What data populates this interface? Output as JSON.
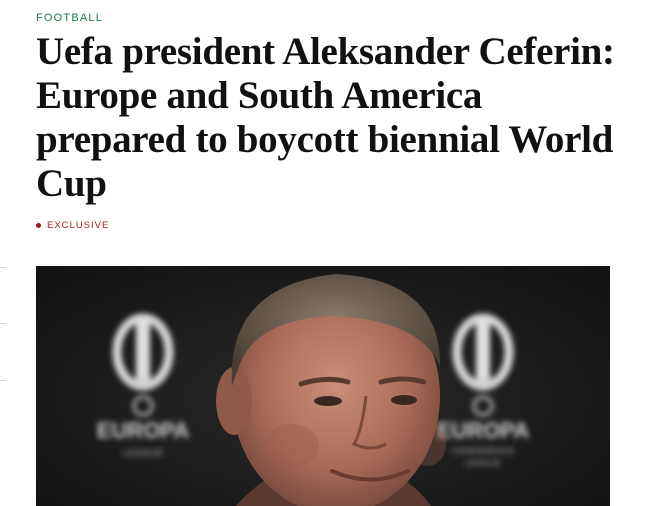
{
  "article": {
    "section": "FOOTBALL",
    "headline": "Uefa president Aleksander Ceferin: Europe and South America prepared to boycott biennial World Cup",
    "tag": "EXCLUSIVE"
  },
  "photo": {
    "background_logo_left": {
      "line1": "EUROPA",
      "line2": "LEAGUE"
    },
    "background_logo_right": {
      "line1": "EUROPA",
      "line2": "CONFERENCE",
      "line3": "LEAGUE"
    }
  },
  "colors": {
    "section": "#1f7a4c",
    "tag": "#a4171d",
    "headline": "#111111"
  }
}
